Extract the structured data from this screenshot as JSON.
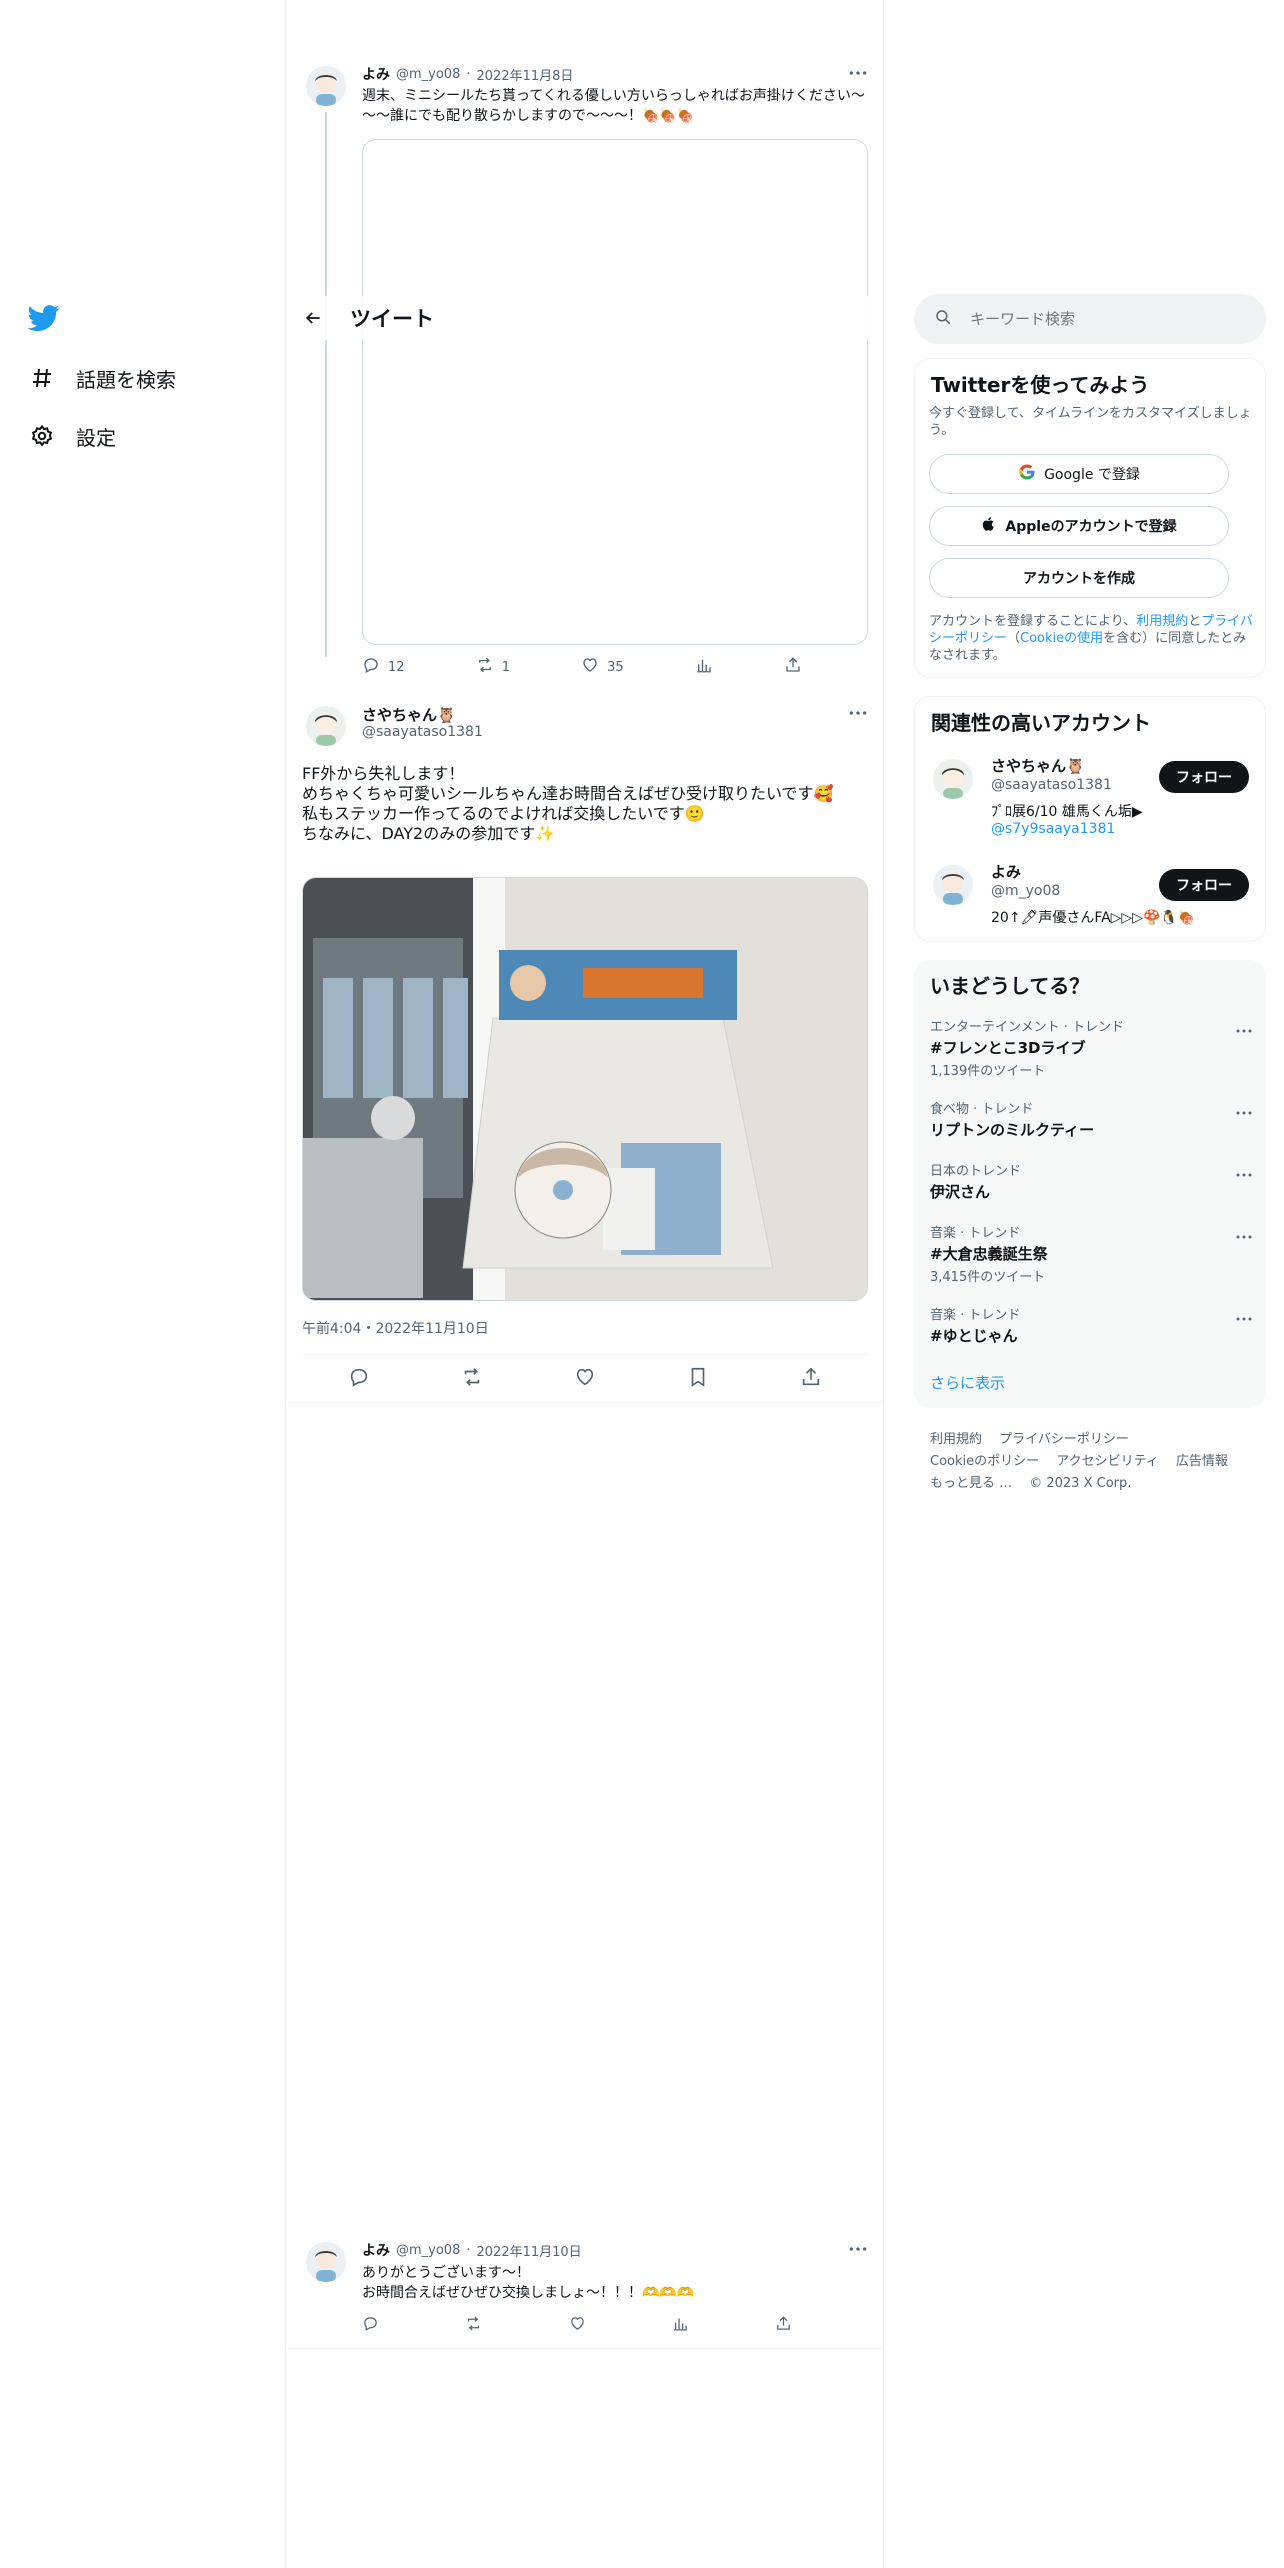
{
  "nav": {
    "logo": "twitter-bird-icon",
    "items": [
      {
        "label": "話題を検索",
        "icon": "hashtag-icon"
      },
      {
        "label": "設定",
        "icon": "gear-icon"
      }
    ]
  },
  "header": {
    "title": "ツイート"
  },
  "quoted_tweet": {
    "name": "よみ",
    "handle": "@m_yo08",
    "date": "2022年11月8日",
    "text": "週末、ミニシールたち貰ってくれる優しい方いらっしゃればお声掛けください～～～誰にでも配り散らかしますので～～～！🍖🍖🍖",
    "replies": "12",
    "retweets": "1",
    "likes": "35"
  },
  "main_tweet": {
    "name": "さやちゃん🦉",
    "handle": "@saayataso1381",
    "text": "FF外から失礼します！\nめちゃくちゃ可愛いシールちゃん達お時間合えばぜひ受け取りたいです🥰\n私もステッカー作ってるのでよければ交換したいです🙂\nちなみに、DAY2のみの参加です✨",
    "timestamp": "午前4:04・2022年11月10日"
  },
  "reply_tweet": {
    "name": "よみ",
    "handle": "@m_yo08",
    "date": "2022年11月10日",
    "text": "ありがとうございます～！\nお時間合えばぜひぜひ交換しましょ～！！！🫶🫶🫶"
  },
  "search": {
    "placeholder": "キーワード検索"
  },
  "signup": {
    "title": "Twitterを使ってみよう",
    "subtitle": "今すぐ登録して、タイムラインをカスタマイズしましょう。",
    "google_label": "Google で登録",
    "apple_label": "Appleのアカウントで登録",
    "create_label": "アカウントを作成",
    "terms_prefix": "アカウントを登録することにより、",
    "terms_link": "利用規約",
    "terms_and": "と",
    "privacy_link": "プライバシーポリシー",
    "cookie_open": "（",
    "cookie_link": "Cookieの使用",
    "terms_suffix": "を含む）に同意したとみなされます。"
  },
  "related": {
    "title": "関連性の高いアカウント",
    "accounts": [
      {
        "name": "さやちゃん🦉",
        "handle": "@saayataso1381",
        "bio": "ﾌﾟﾛ展6/10 雄馬くん垢▶",
        "bio_link": "@s7y9saaya1381",
        "follow": "フォロー"
      },
      {
        "name": "よみ",
        "handle": "@m_yo08",
        "bio": "20↑🖊声優さんFA▷▷▷🍄🐧🍖",
        "bio_link": "",
        "follow": "フォロー"
      }
    ]
  },
  "trends": {
    "title": "いまどうしてる？",
    "items": [
      {
        "category": "エンターテインメント · トレンド",
        "name": "#フレンとこ3Dライブ",
        "count": "1,139件のツイート"
      },
      {
        "category": "食べ物 · トレンド",
        "name": "リプトンのミルクティー",
        "count": ""
      },
      {
        "category": "日本のトレンド",
        "name": "伊沢さん",
        "count": ""
      },
      {
        "category": "音楽 · トレンド",
        "name": "#大倉忠義誕生祭",
        "count": "3,415件のツイート"
      },
      {
        "category": "音楽 · トレンド",
        "name": "#ゆとじゃん",
        "count": ""
      }
    ],
    "show_more": "さらに表示"
  },
  "footer": {
    "terms": "利用規約",
    "privacy": "プライバシーポリシー",
    "cookie": "Cookieのポリシー",
    "accessibility": "アクセシビリティ",
    "ads": "広告情報",
    "more": "もっと見る …",
    "copyright": "© 2023 X Corp."
  },
  "colors": {
    "accent": "#1d9bf0",
    "text": "#0f1419",
    "muted": "#536471",
    "border": "#eff3f4"
  }
}
